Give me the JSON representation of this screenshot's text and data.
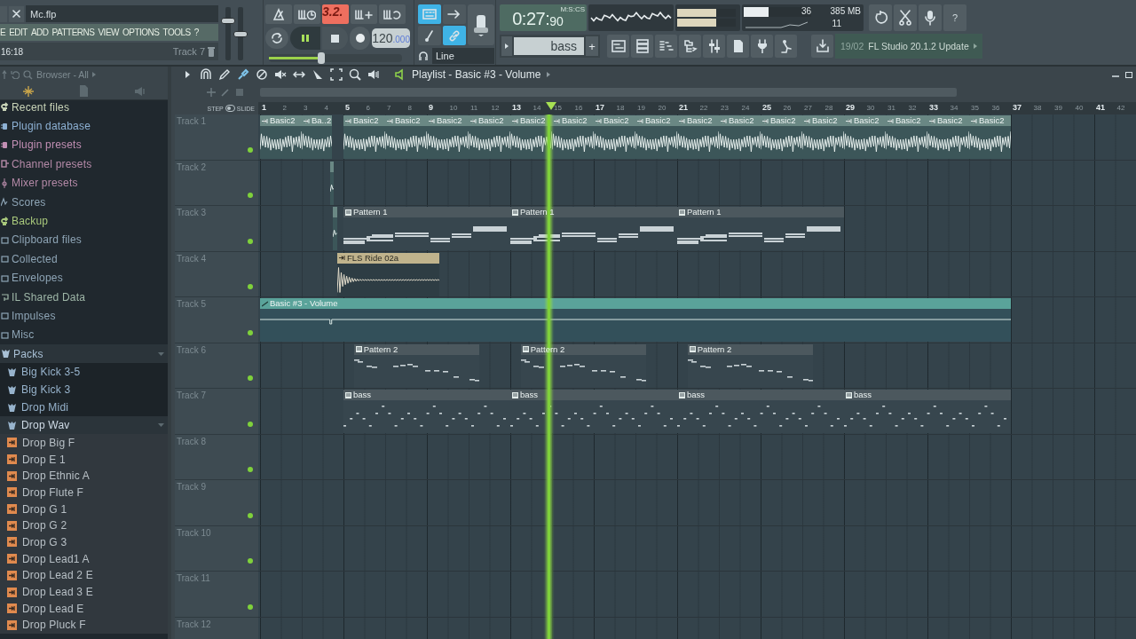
{
  "window": {
    "title": "Mc.flp"
  },
  "menu": [
    "E",
    "EDIT",
    "ADD",
    "PATTERNS",
    "VIEW",
    "OPTIONS",
    "TOOLS",
    "?"
  ],
  "hint_bar": {
    "time": "16:18",
    "target": "Track 7"
  },
  "master_volume": {
    "level": 0.78
  },
  "master_pitch": {
    "level": 0.5
  },
  "transport": {
    "pattern_display": "3.2.",
    "playing": true,
    "tempo": "120",
    "tempo_fraction": ".000",
    "position": {
      "level": 0.39
    }
  },
  "toggle_buttons": [
    {
      "on": true
    },
    {
      "on": false
    },
    {
      "on": false
    },
    {
      "on": true
    }
  ],
  "snap_mode": "Line",
  "time_display": {
    "value": "0:27:",
    "centiseconds": "90",
    "format": "M:S:CS"
  },
  "output_meters": [
    {
      "level": 0.66
    },
    {
      "level": 0.66
    }
  ],
  "cpu": {
    "level": 0.37,
    "reading": "36",
    "memory": "385 MB",
    "polyphony": "11"
  },
  "help_button": "?",
  "pattern_selector": {
    "value": "bass",
    "add": "+"
  },
  "news": {
    "date": "19/02",
    "text": "FL Studio 20.1.2 Update"
  },
  "browser": {
    "title": "Browser - All",
    "items": [
      {
        "label": "Recent files",
        "kind": "history",
        "color": "#c9d4b8"
      },
      {
        "label": "Plugin database",
        "kind": "plugin",
        "color": "#8db1d4"
      },
      {
        "label": "Plugin presets",
        "kind": "plugin",
        "color": "#c28fb4"
      },
      {
        "label": "Channel presets",
        "kind": "preset",
        "color": "#b58aa8"
      },
      {
        "label": "Mixer presets",
        "kind": "mixer",
        "color": "#b58aa8"
      },
      {
        "label": "Scores",
        "kind": "score",
        "color": "#8ea5b6"
      },
      {
        "label": "Backup",
        "kind": "history",
        "color": "#a9c97c"
      },
      {
        "label": "Clipboard files",
        "kind": "folder",
        "color": "#8ea5b6"
      },
      {
        "label": "Collected",
        "kind": "folder",
        "color": "#8ea5b6"
      },
      {
        "label": "Envelopes",
        "kind": "folder",
        "color": "#8ea5b6"
      },
      {
        "label": "IL Shared Data",
        "kind": "shared",
        "color": "#9fb7a8"
      },
      {
        "label": "Impulses",
        "kind": "folder",
        "color": "#8ea5b6"
      },
      {
        "label": "Misc",
        "kind": "folder",
        "color": "#8ea5b6"
      },
      {
        "label": "Packs",
        "kind": "pack",
        "color": "#a9c1d6",
        "children": [
          {
            "label": "Big Kick 3-5",
            "kind": "pack"
          },
          {
            "label": "Big Kick 3",
            "kind": "pack"
          },
          {
            "label": "Drop Midi",
            "kind": "pack"
          },
          {
            "label": "Drop Wav",
            "kind": "pack",
            "children": [
              {
                "label": "Drop Big F",
                "kind": "audio"
              },
              {
                "label": "Drop E 1",
                "kind": "audio"
              },
              {
                "label": "Drop Ethnic A",
                "kind": "audio"
              },
              {
                "label": "Drop Flute F",
                "kind": "audio"
              },
              {
                "label": "Drop G 1",
                "kind": "audio"
              },
              {
                "label": "Drop G 2",
                "kind": "audio"
              },
              {
                "label": "Drop G 3",
                "kind": "audio"
              },
              {
                "label": "Drop Lead1 A",
                "kind": "audio"
              },
              {
                "label": "Drop Lead 2 E",
                "kind": "audio"
              },
              {
                "label": "Drop Lead 3 E",
                "kind": "audio"
              },
              {
                "label": "Drop Lead E",
                "kind": "audio"
              },
              {
                "label": "Drop Pluck F",
                "kind": "audio"
              }
            ]
          }
        ]
      }
    ]
  },
  "playlist": {
    "title": "Playlist - Basic #3 - Volume",
    "snap_labels": [
      "STEP",
      "SLIDE"
    ],
    "snap_switch": {
      "on": false
    },
    "ruler": [
      "1",
      "2",
      "3",
      "4",
      "5",
      "6",
      "7",
      "8",
      "9",
      "10",
      "11",
      "12",
      "13",
      "14",
      "15",
      "16",
      "17",
      "18",
      "19",
      "20",
      "21",
      "22",
      "23",
      "24",
      "25",
      "26",
      "27",
      "28",
      "29",
      "30",
      "31",
      "32",
      "33",
      "34",
      "35",
      "36",
      "37",
      "38",
      "39",
      "40",
      "41",
      "42"
    ],
    "tracks": [
      {
        "name": "Track 1",
        "muted": false,
        "clips": [
          {
            "kind": "audio",
            "label": "Basic2",
            "color": "#6a8884"
          },
          {
            "kind": "audio",
            "label": "Ba..2",
            "color": "#6a8884"
          },
          {
            "kind": "audio",
            "label": "Basic2",
            "color": "#6a8884"
          },
          {
            "kind": "audio",
            "label": "Basic2",
            "color": "#6a8884"
          },
          {
            "kind": "audio",
            "label": "Basic2",
            "color": "#6a8884"
          },
          {
            "kind": "audio",
            "label": "Basic2",
            "color": "#6a8884"
          },
          {
            "kind": "audio",
            "label": "Basic2",
            "color": "#6a8884"
          },
          {
            "kind": "audio",
            "label": "Basic2",
            "color": "#6a8884"
          },
          {
            "kind": "audio",
            "label": "Basic2",
            "color": "#6a8884"
          },
          {
            "kind": "audio",
            "label": "Basic2",
            "color": "#6a8884"
          },
          {
            "kind": "audio",
            "label": "Basic2",
            "color": "#6a8884"
          },
          {
            "kind": "audio",
            "label": "Basic2",
            "color": "#6a8884"
          },
          {
            "kind": "audio",
            "label": "Basic2",
            "color": "#6a8884"
          },
          {
            "kind": "audio",
            "label": "Basic2",
            "color": "#6a8884"
          },
          {
            "kind": "audio",
            "label": "Basic2",
            "color": "#6a8884"
          },
          {
            "kind": "audio",
            "label": "Basic2",
            "color": "#6a8884"
          },
          {
            "kind": "audio",
            "label": "Basic2",
            "color": "#6a8884"
          },
          {
            "kind": "audio",
            "label": "Basic2",
            "color": "#6a8884"
          }
        ]
      },
      {
        "name": "Track 2",
        "muted": false,
        "clips": [
          {
            "kind": "audio",
            "color": "#6a8884"
          }
        ]
      },
      {
        "name": "Track 3",
        "muted": false,
        "clips": [
          {
            "kind": "audio",
            "color": "#6a8884"
          },
          {
            "kind": "pattern",
            "label": "Pattern 1",
            "color": "#4c585e"
          },
          {
            "kind": "pattern",
            "label": "Pattern 1",
            "color": "#4c585e"
          },
          {
            "kind": "pattern",
            "label": "Pattern 1",
            "color": "#4c585e"
          }
        ]
      },
      {
        "name": "Track 4",
        "muted": false,
        "clips": [
          {
            "kind": "audio",
            "label": "FLS Ride 02a",
            "color": "#c0b38c"
          }
        ]
      },
      {
        "name": "Track 5",
        "muted": false,
        "clips": [
          {
            "kind": "automation",
            "label": "Basic #3 - Volume",
            "color": "#5aa39a"
          }
        ]
      },
      {
        "name": "Track 6",
        "muted": false,
        "clips": [
          {
            "kind": "pattern",
            "label": "Pattern 2",
            "color": "#4c585e"
          },
          {
            "kind": "pattern",
            "label": "Pattern 2",
            "color": "#4c585e"
          },
          {
            "kind": "pattern",
            "label": "Pattern 2",
            "color": "#4c585e"
          }
        ]
      },
      {
        "name": "Track 7",
        "muted": false,
        "clips": [
          {
            "kind": "pattern",
            "label": "bass",
            "color": "#4c585e"
          },
          {
            "kind": "pattern",
            "label": "bass",
            "color": "#4c585e"
          },
          {
            "kind": "pattern",
            "label": "bass",
            "color": "#4c585e"
          },
          {
            "kind": "pattern",
            "label": "bass",
            "color": "#4c585e"
          }
        ]
      },
      {
        "name": "Track 8",
        "muted": false
      },
      {
        "name": "Track 9",
        "muted": false
      },
      {
        "name": "Track 10",
        "muted": false
      },
      {
        "name": "Track 11",
        "muted": false
      },
      {
        "name": "Track 12"
      }
    ]
  }
}
